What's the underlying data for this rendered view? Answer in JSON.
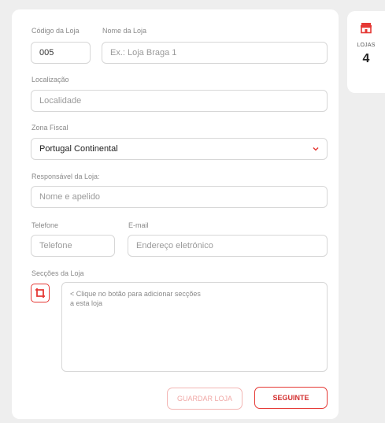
{
  "sidebar": {
    "stores_icon": "store-icon",
    "label": "LOJAS",
    "count": "4"
  },
  "form": {
    "code": {
      "label": "Código da Loja",
      "value": "005"
    },
    "name": {
      "label": "Nome da Loja",
      "placeholder": "Ex.: Loja Braga 1"
    },
    "location": {
      "label": "Localização",
      "placeholder": "Localidade"
    },
    "fiscal_zone": {
      "label": "Zona Fiscal",
      "value": "Portugal Continental",
      "icon": "chevron-down-icon"
    },
    "manager": {
      "label": "Responsável da Loja:",
      "placeholder": "Nome e apelido"
    },
    "phone": {
      "label": "Telefone",
      "placeholder": "Telefone"
    },
    "email": {
      "label": "E-mail",
      "placeholder": "Endereço eletrónico"
    },
    "sections": {
      "label": "Secções da Loja",
      "add_icon": "add-section-icon",
      "hint_line1": "< Clique no botão para adicionar secções",
      "hint_line2": "a esta loja"
    }
  },
  "buttons": {
    "save": "GUARDAR LOJA",
    "next": "SEGUINTE"
  },
  "colors": {
    "accent": "#e53935",
    "disabled_accent": "#f3b6b4",
    "background": "#eeeeee"
  }
}
